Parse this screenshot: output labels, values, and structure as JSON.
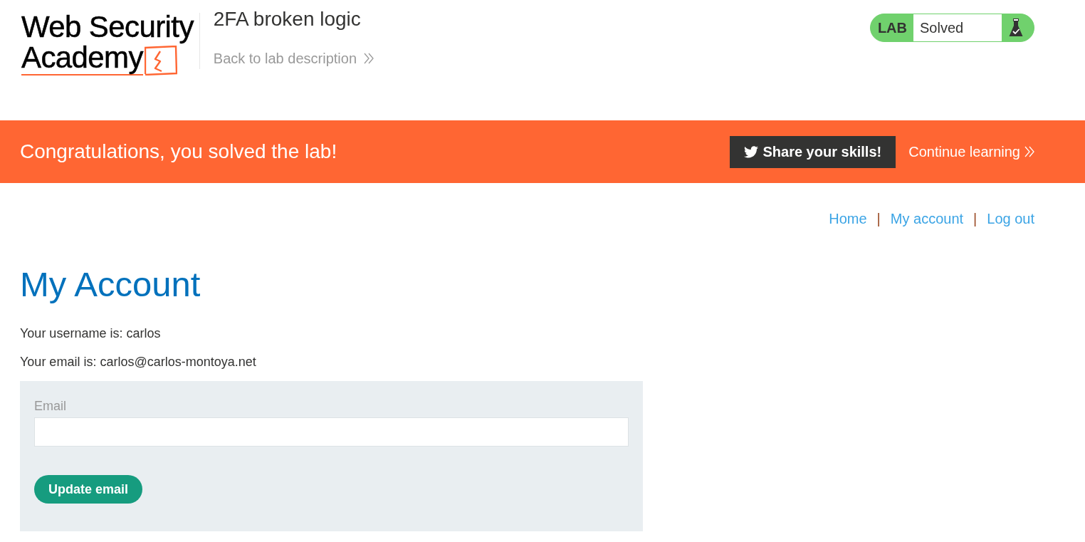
{
  "header": {
    "logo": {
      "line_1": "Web Security",
      "line_2": "Academy"
    },
    "lab_title": "2FA broken logic",
    "back_link": "Back to lab description",
    "lab_status": {
      "label": "LAB",
      "status": "Solved",
      "solved": true
    }
  },
  "banner": {
    "message": "Congratulations, you solved the lab!",
    "share_button": "Share your skills!",
    "continue_link": "Continue learning"
  },
  "nav": {
    "links": [
      {
        "label": "Home"
      },
      {
        "label": "My account"
      },
      {
        "label": "Log out"
      }
    ],
    "separators": [
      "|",
      "|"
    ]
  },
  "page": {
    "heading": "My Account",
    "lines": [
      "Your username is: carlos",
      "Your email is: carlos@carlos-montoya.net"
    ],
    "form": {
      "field": {
        "label": "Email"
      },
      "button": "Update email"
    }
  }
}
